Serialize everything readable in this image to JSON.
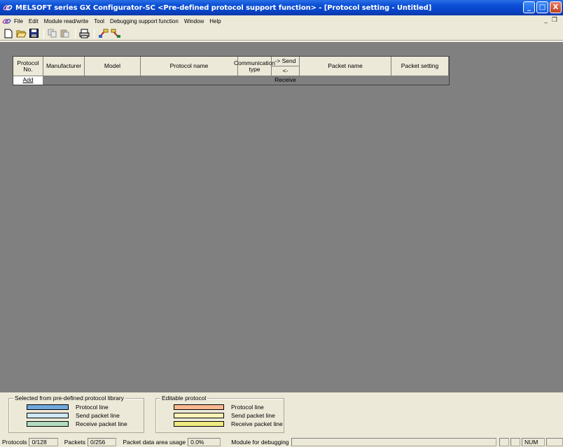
{
  "window": {
    "title": "MELSOFT series  GX Configurator-SC <Pre-defined protocol support function> - [Protocol setting - Untitled]",
    "minimize": "_",
    "maximize": "□",
    "close": "X"
  },
  "menubar": {
    "items": [
      "File",
      "Edit",
      "Module read/write",
      "Tool",
      "Debugging support function",
      "Window",
      "Help"
    ],
    "mdi_minimize": "_",
    "mdi_restore": "❐"
  },
  "toolbar": {
    "icons": [
      "new-icon",
      "open-icon",
      "save-icon",
      "copy-icon",
      "paste-icon",
      "print-icon",
      "read-icon",
      "write-icon"
    ]
  },
  "grid": {
    "headers": {
      "protocol_no": "Protocol No.",
      "manufacturer": "Manufacturer",
      "model": "Model",
      "protocol_name": "Protocol name",
      "communication_type": "Communication type",
      "send": "-> Send",
      "receive": "<- Receive",
      "packet_name": "Packet name",
      "packet_setting": "Packet setting"
    },
    "add_label": "Add"
  },
  "legend": {
    "library": {
      "title": "Selected from pre-defined protocol library",
      "items": [
        {
          "label": "Protocol line",
          "color": "#6fa8dc"
        },
        {
          "label": "Send packet line",
          "color": "#cfe8f6"
        },
        {
          "label": "Receive packet line",
          "color": "#b4dcc0"
        }
      ]
    },
    "editable": {
      "title": "Editable protocol",
      "items": [
        {
          "label": "Protocol line",
          "color": "#f9b890"
        },
        {
          "label": "Send packet line",
          "color": "#fdf4b8"
        },
        {
          "label": "Receive packet line",
          "color": "#f0ea80"
        }
      ]
    }
  },
  "statusbar": {
    "protocols_label": "Protocols",
    "protocols_value": "0/128",
    "packets_label": "Packets",
    "packets_value": "0/256",
    "usage_label": "Packet data area usage",
    "usage_value": "0.0%",
    "debug_label": "Module for debugging",
    "num": "NUM"
  }
}
